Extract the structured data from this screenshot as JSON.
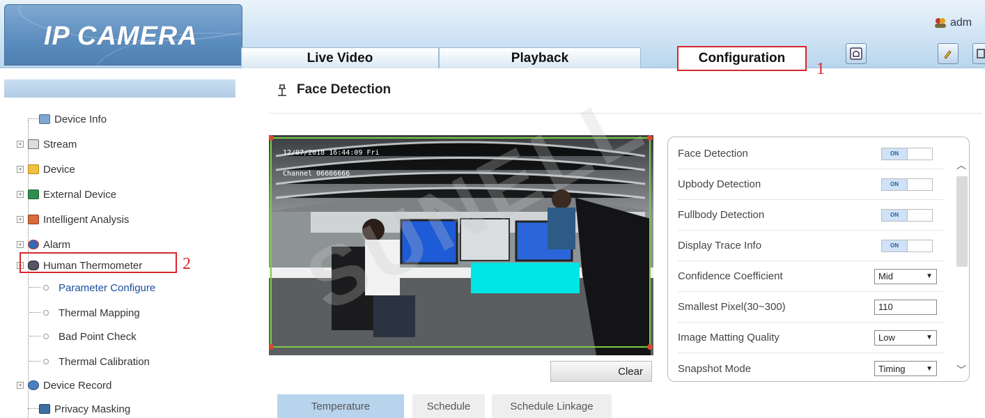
{
  "header": {
    "logo": "IP CAMERA",
    "tabs": [
      {
        "label": "Live Video"
      },
      {
        "label": "Playback"
      },
      {
        "label": "Configuration"
      }
    ],
    "annotation_1": "1",
    "user": "adm",
    "icons": [
      "alarm-bell-icon",
      "help-icon",
      "logout-icon"
    ]
  },
  "sidebar": {
    "items": [
      {
        "label": "Device Info",
        "icon": "device-info-icon"
      },
      {
        "label": "Stream",
        "icon": "stream-icon"
      },
      {
        "label": "Device",
        "icon": "device-icon"
      },
      {
        "label": "External Device",
        "icon": "external-device-icon"
      },
      {
        "label": "Intelligent Analysis",
        "icon": "intelligent-analysis-icon"
      },
      {
        "label": "Alarm",
        "icon": "alarm-icon"
      },
      {
        "label": "Human Thermometer",
        "icon": "thermometer-icon"
      },
      {
        "label": "Parameter Configure"
      },
      {
        "label": "Thermal Mapping"
      },
      {
        "label": "Bad Point Check"
      },
      {
        "label": "Thermal Calibration"
      },
      {
        "label": "Device Record",
        "icon": "device-record-icon"
      },
      {
        "label": "Privacy Masking",
        "icon": "privacy-masking-icon"
      }
    ],
    "annotation_2": "2"
  },
  "main": {
    "title": "Face Detection",
    "video": {
      "osd_time": "12/07/2018 16:44:09 Fri",
      "osd_channel": "Channel 06666666"
    },
    "clear_label": "Clear",
    "params": [
      {
        "label": "Face Detection",
        "type": "toggle",
        "value": "ON"
      },
      {
        "label": "Upbody Detection",
        "type": "toggle",
        "value": "ON"
      },
      {
        "label": "Fullbody Detection",
        "type": "toggle",
        "value": "ON"
      },
      {
        "label": "Display Trace Info",
        "type": "toggle",
        "value": "ON"
      },
      {
        "label": "Confidence Coefficient",
        "type": "select",
        "value": "Mid"
      },
      {
        "label": "Smallest Pixel(30~300)",
        "type": "input",
        "value": "110"
      },
      {
        "label": "Image Matting Quality",
        "type": "select",
        "value": "Low"
      },
      {
        "label": "Snapshot Mode",
        "type": "select",
        "value": "Timing"
      }
    ],
    "bottom_tabs": [
      {
        "label": "Temperature"
      },
      {
        "label": "Schedule"
      },
      {
        "label": "Schedule Linkage"
      }
    ]
  },
  "watermark": "SUNELL",
  "colors": {
    "accent_red": "#d9262b",
    "header_blue": "#5c8dbf",
    "active_tab": "#b8d3ec",
    "roi_green": "#7ccc44",
    "cyan_block": "#00e5e5"
  }
}
